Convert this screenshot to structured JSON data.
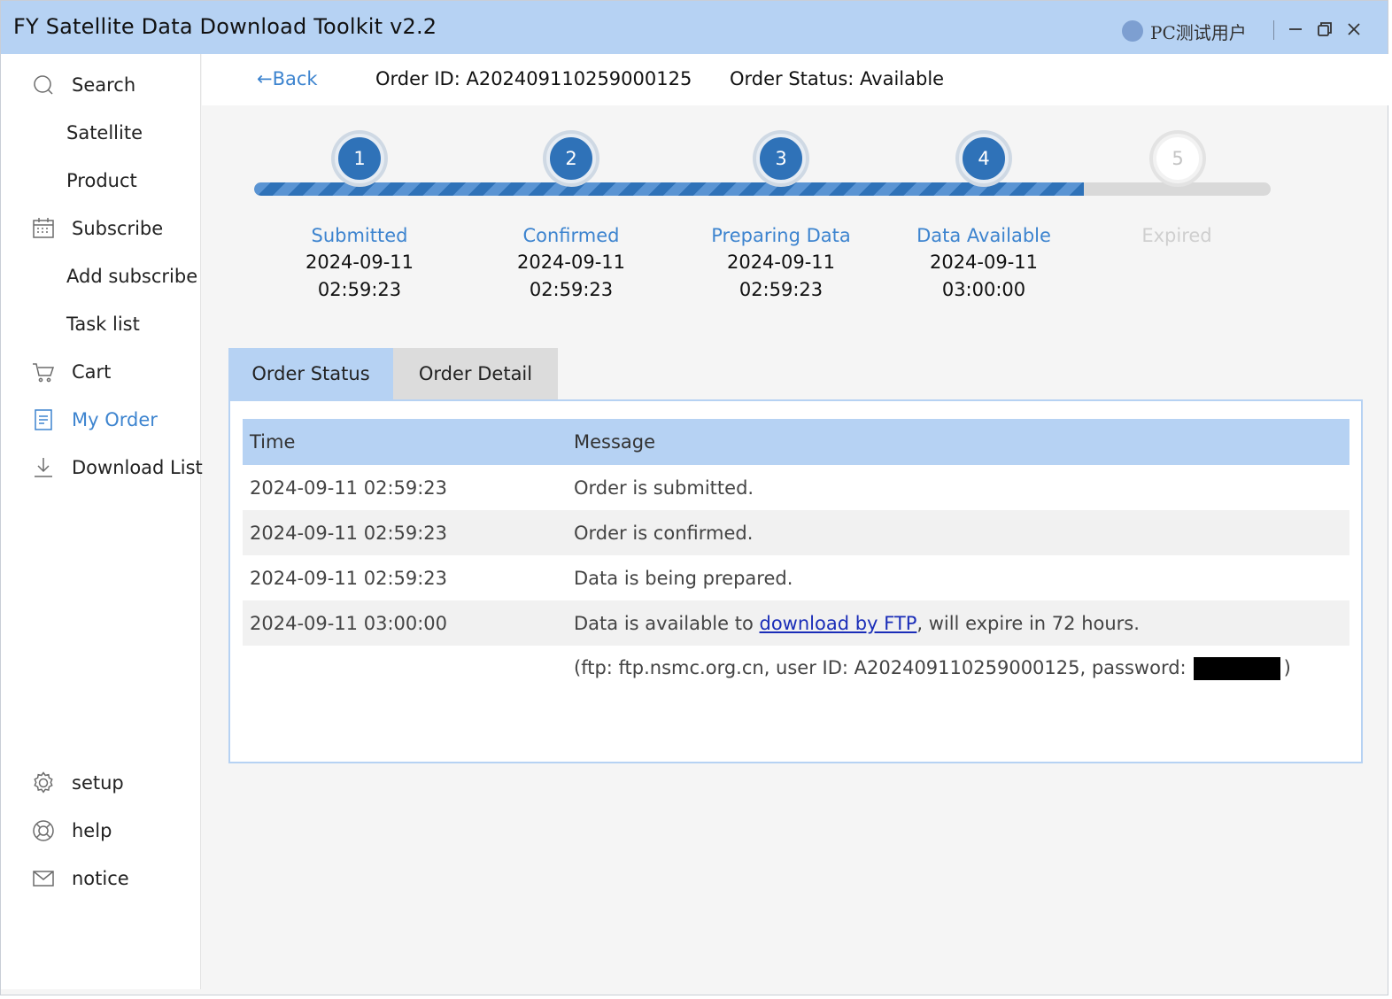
{
  "window": {
    "title": "FY Satellite Data Download Toolkit v2.2",
    "user_name": "PC测试用户"
  },
  "sidebar": {
    "items": [
      {
        "label": "Search",
        "icon": "search-icon"
      },
      {
        "label": "Satellite"
      },
      {
        "label": "Product"
      },
      {
        "label": "Subscribe",
        "icon": "calendar-icon"
      },
      {
        "label": "Add subscribe"
      },
      {
        "label": "Task list"
      },
      {
        "label": "Cart",
        "icon": "cart-icon"
      },
      {
        "label": "My Order",
        "icon": "document-icon",
        "active": true
      },
      {
        "label": "Download List",
        "icon": "download-icon"
      }
    ],
    "bottom_items": [
      {
        "label": "setup",
        "icon": "gear-icon"
      },
      {
        "label": "help",
        "icon": "lifebuoy-icon"
      },
      {
        "label": "notice",
        "icon": "mail-icon"
      }
    ]
  },
  "topbar": {
    "back_label": "←Back",
    "order_id": "Order ID: A202409110259000125",
    "order_status": "Order Status: Available"
  },
  "progress": {
    "completed_fraction": 0.816,
    "steps": [
      {
        "number": "1",
        "name": "Submitted",
        "date": "2024-09-11",
        "time": "02:59:23",
        "done": true
      },
      {
        "number": "2",
        "name": "Confirmed",
        "date": "2024-09-11",
        "time": "02:59:23",
        "done": true
      },
      {
        "number": "3",
        "name": "Preparing Data",
        "date": "2024-09-11",
        "time": "02:59:23",
        "done": true
      },
      {
        "number": "4",
        "name": "Data Available",
        "date": "2024-09-11",
        "time": "03:00:00",
        "done": true
      },
      {
        "number": "5",
        "name": "Expired",
        "date": "",
        "time": "",
        "done": false
      }
    ]
  },
  "tabs": {
    "active": "Order Status",
    "inactive": "Order Detail"
  },
  "status_table": {
    "headers": {
      "time": "Time",
      "message": "Message"
    },
    "rows": [
      {
        "time": "2024-09-11 02:59:23",
        "message": "Order is submitted."
      },
      {
        "time": "2024-09-11 02:59:23",
        "message": "Order is confirmed."
      },
      {
        "time": "2024-09-11 02:59:23",
        "message": "Data is being prepared."
      },
      {
        "time": "2024-09-11 03:00:00",
        "message_prefix": "Data is available to ",
        "link_text": "download by FTP",
        "message_suffix": ", will expire in 72 hours."
      }
    ],
    "ftp_line_prefix": "(ftp: ftp.nsmc.org.cn, user ID: A202409110259000125, password:",
    "ftp_line_suffix": ")"
  },
  "colors": {
    "accent": "#3d84cf",
    "header_blue": "#b6d2f3",
    "step_blue": "#2f72b8",
    "link": "#1a2db8"
  }
}
